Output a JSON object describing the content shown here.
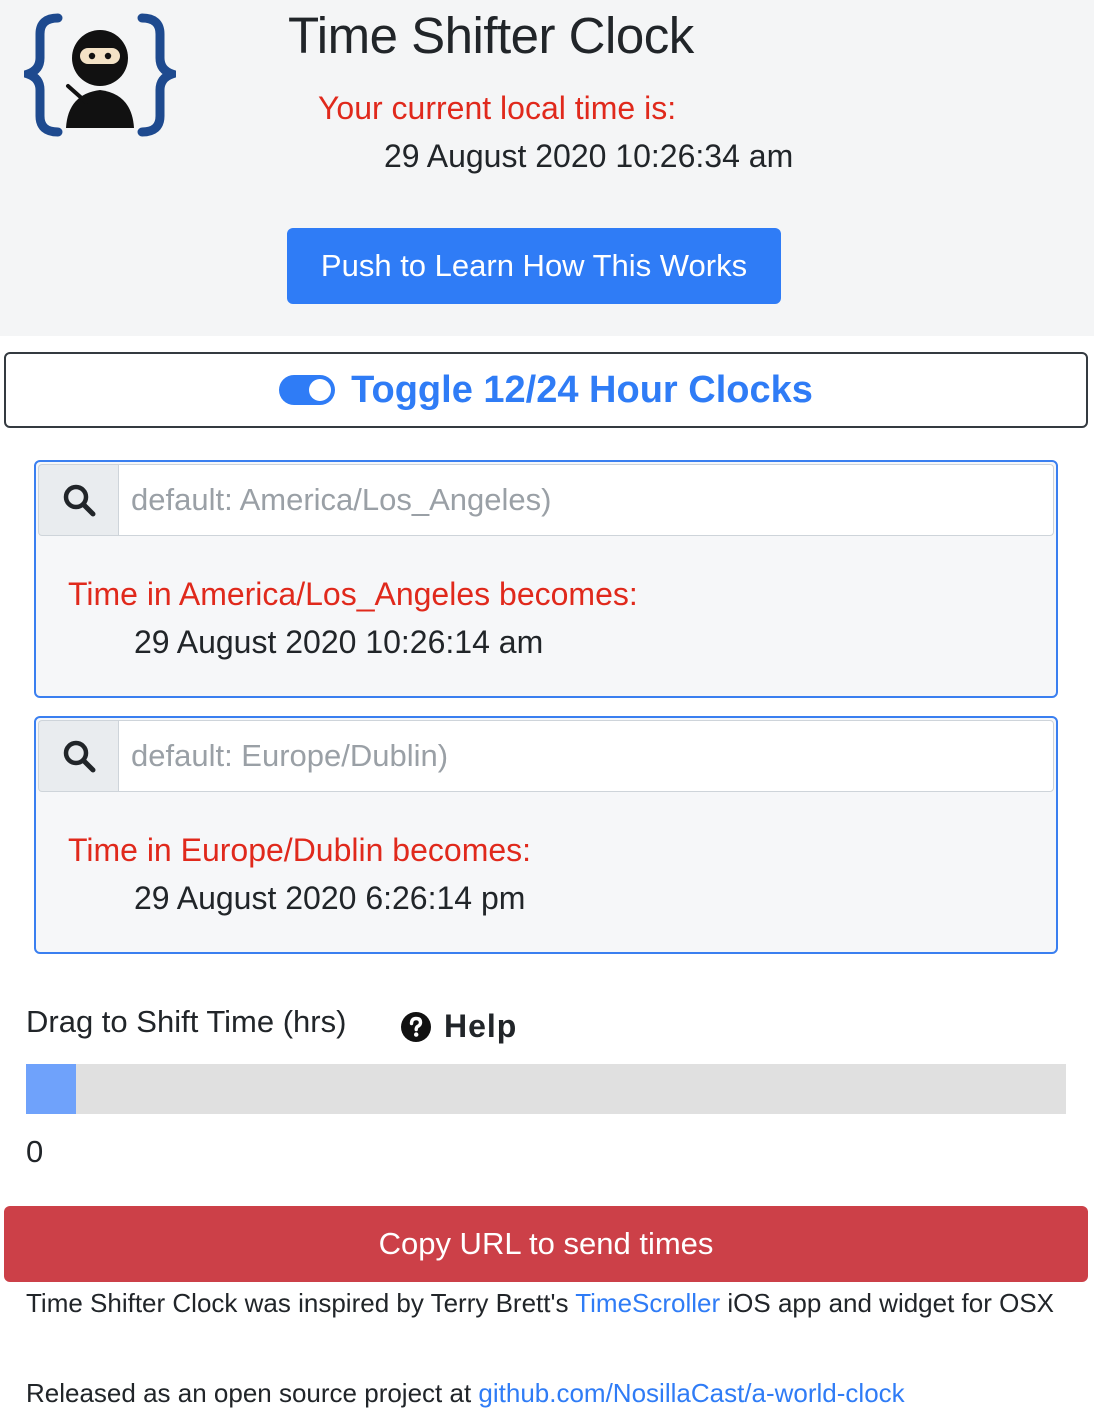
{
  "header": {
    "logo_icon": "ninja-braces-logo-icon",
    "title": "Time Shifter Clock",
    "local_time_label": "Your current local time is:",
    "local_time": "29 August 2020 10:26:34 am",
    "learn_button": "Push to Learn How This Works"
  },
  "toggle": {
    "label": "Toggle 12/24 Hour Clocks",
    "state": "on",
    "icon": "toggle-switch-icon"
  },
  "zones": [
    {
      "placeholder": "default: America/Los_Angeles)",
      "value": "",
      "label": "Time in America/Los_Angeles becomes:",
      "time": "29 August 2020 10:26:14 am",
      "icon": "search-icon"
    },
    {
      "placeholder": "default: Europe/Dublin)",
      "value": "",
      "label": "Time in Europe/Dublin becomes:",
      "time": "29 August 2020 6:26:14 pm",
      "icon": "search-icon"
    }
  ],
  "shift": {
    "label": "Drag to Shift Time (hrs)",
    "help_label": "Help",
    "help_icon": "question-circle-icon",
    "value": "0"
  },
  "copy_button": "Copy URL to send times",
  "footer": {
    "credit_prefix": "Time Shifter Clock was inspired by Terry Brett's ",
    "credit_link": "TimeScroller",
    "credit_suffix": " iOS app and widget for OSX",
    "release_prefix": "Released as an open source project at ",
    "release_link": "github.com/NosillaCast/a-world-clock"
  },
  "colors": {
    "primary": "#2f7cf6",
    "danger": "#cc4048",
    "label_red": "#e0291c",
    "header_bg": "#f4f5f6"
  }
}
